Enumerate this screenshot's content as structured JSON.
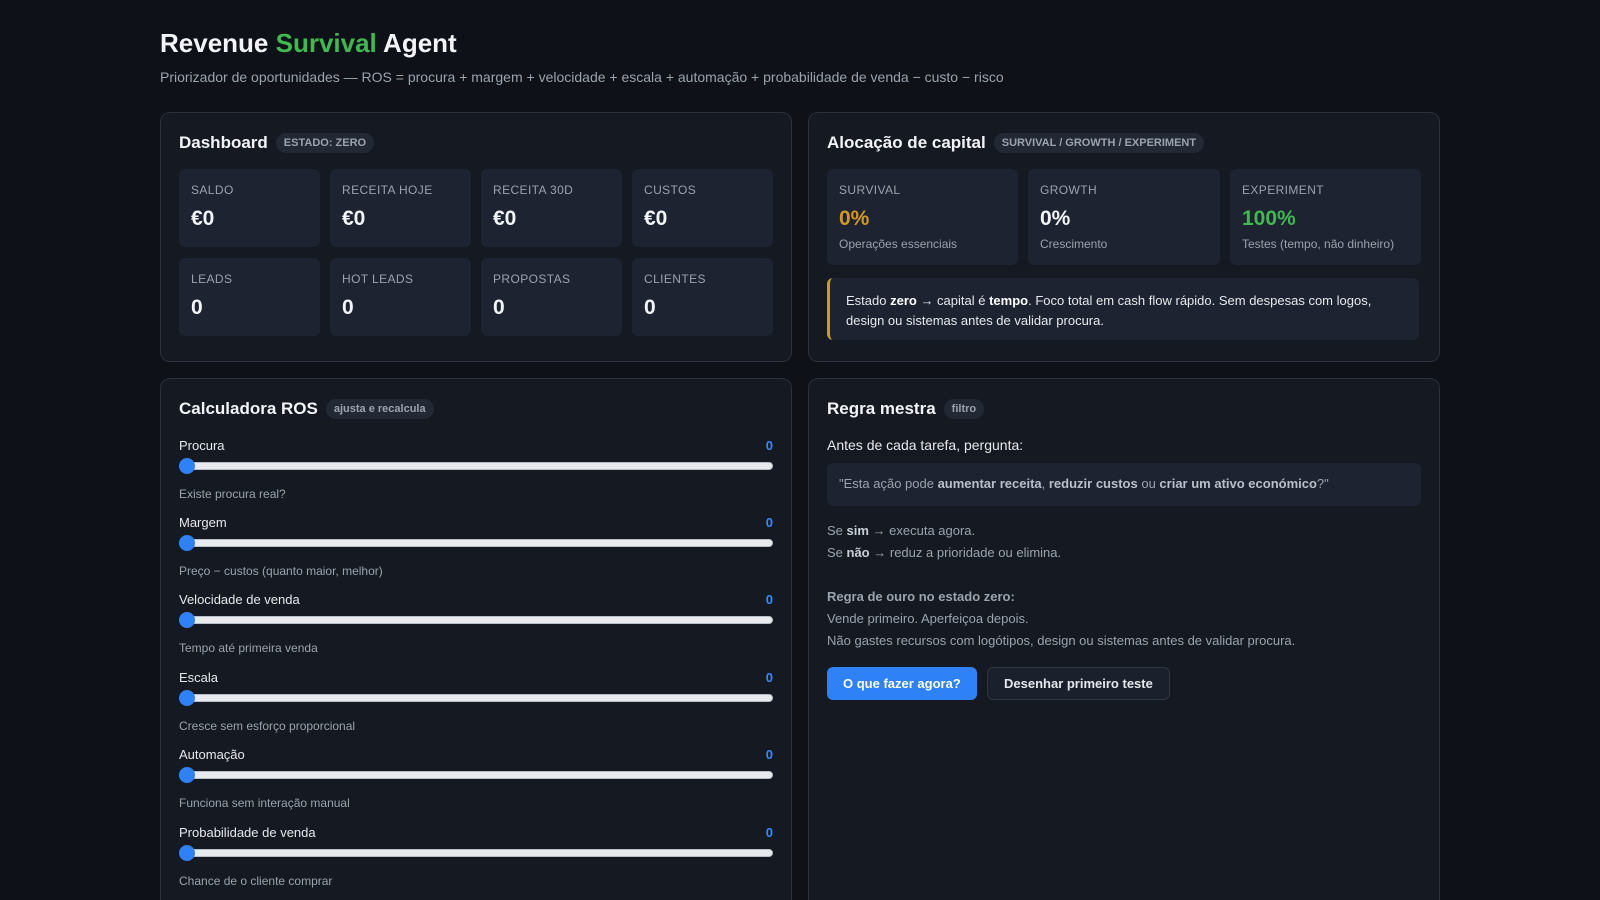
{
  "header": {
    "title_pre": "Revenue ",
    "title_accent": "Survival",
    "title_post": " Agent",
    "subtitle": "Priorizador de oportunidades — ROS = procura + margem + velocidade + escala + automação + probabilidade de venda − custo − risco"
  },
  "dashboard": {
    "title": "Dashboard",
    "badge": "ESTADO: ZERO",
    "tiles": [
      {
        "label": "SALDO",
        "value": "€0"
      },
      {
        "label": "RECEITA HOJE",
        "value": "€0"
      },
      {
        "label": "RECEITA 30D",
        "value": "€0"
      },
      {
        "label": "CUSTOS",
        "value": "€0"
      },
      {
        "label": "LEADS",
        "value": "0"
      },
      {
        "label": "HOT LEADS",
        "value": "0"
      },
      {
        "label": "PROPOSTAS",
        "value": "0"
      },
      {
        "label": "CLIENTES",
        "value": "0"
      }
    ]
  },
  "allocation": {
    "title": "Alocação de capital",
    "badge": "SURVIVAL / GROWTH / EXPERIMENT",
    "tiles": [
      {
        "label": "SURVIVAL",
        "value": "0%",
        "desc": "Operações essenciais",
        "color": "#d29922"
      },
      {
        "label": "GROWTH",
        "value": "0%",
        "desc": "Crescimento",
        "color": "#f2f4f7"
      },
      {
        "label": "EXPERIMENT",
        "value": "100%",
        "desc": "Testes (tempo, não dinheiro)",
        "color": "#3fb950"
      }
    ],
    "note": {
      "t1": "Estado ",
      "b1": "zero",
      "t2": " → capital é ",
      "b2": "tempo",
      "t3": ". Foco total em cash flow rápido. Sem despesas com logos, design ou sistemas antes de validar procura."
    }
  },
  "calculator": {
    "title": "Calculadora ROS",
    "badge": "ajusta e recalcula",
    "sliders": [
      {
        "label": "Procura",
        "value": "0",
        "desc": "Existe procura real?"
      },
      {
        "label": "Margem",
        "value": "0",
        "desc": "Preço − custos (quanto maior, melhor)"
      },
      {
        "label": "Velocidade de venda",
        "value": "0",
        "desc": "Tempo até primeira venda"
      },
      {
        "label": "Escala",
        "value": "0",
        "desc": "Cresce sem esforço proporcional"
      },
      {
        "label": "Automação",
        "value": "0",
        "desc": "Funciona sem interação manual"
      },
      {
        "label": "Probabilidade de venda",
        "value": "0",
        "desc": "Chance de o cliente comprar"
      }
    ]
  },
  "master_rule": {
    "title": "Regra mestra",
    "badge": "filtro",
    "ask": "Antes de cada tarefa, pergunta:",
    "quote": {
      "q1": "\"Esta ação pode ",
      "qb1": "aumentar receita",
      "q2": ", ",
      "qb2": "reduzir custos",
      "q3": " ou ",
      "qb3": "criar um ativo económico",
      "q4": "?\""
    },
    "yes": {
      "pre": "Se ",
      "bold": "sim",
      "post": " → executa agora."
    },
    "no": {
      "pre": "Se ",
      "bold": "não",
      "post": " → reduz a prioridade ou elimina."
    },
    "gold_title": "Regra de ouro no estado zero:",
    "gold_1": "Vende primeiro. Aperfeiçoa depois.",
    "gold_2": "Não gastes recursos com logótipos, design ou sistemas antes de validar procura.",
    "btn_primary": "O que fazer agora?",
    "btn_secondary": "Desenhar primeiro teste"
  }
}
